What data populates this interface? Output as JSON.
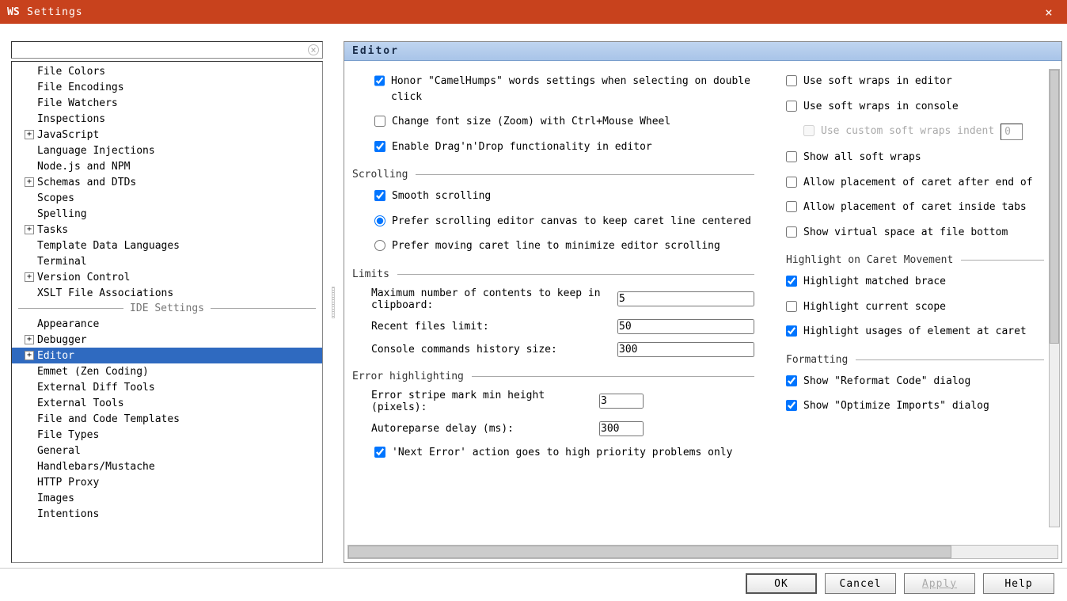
{
  "window": {
    "title": "Settings",
    "logo_letter": "WS"
  },
  "search": {
    "placeholder": ""
  },
  "tree": [
    {
      "label": "File Colors",
      "indent": 1,
      "exp": null
    },
    {
      "label": "File Encodings",
      "indent": 1,
      "exp": null
    },
    {
      "label": "File Watchers",
      "indent": 1,
      "exp": null
    },
    {
      "label": "Inspections",
      "indent": 1,
      "exp": null
    },
    {
      "label": "JavaScript",
      "indent": 1,
      "exp": "+"
    },
    {
      "label": "Language Injections",
      "indent": 1,
      "exp": null
    },
    {
      "label": "Node.js and NPM",
      "indent": 1,
      "exp": null
    },
    {
      "label": "Schemas and DTDs",
      "indent": 1,
      "exp": "+"
    },
    {
      "label": "Scopes",
      "indent": 1,
      "exp": null
    },
    {
      "label": "Spelling",
      "indent": 1,
      "exp": null
    },
    {
      "label": "Tasks",
      "indent": 1,
      "exp": "+"
    },
    {
      "label": "Template Data Languages",
      "indent": 1,
      "exp": null
    },
    {
      "label": "Terminal",
      "indent": 1,
      "exp": null
    },
    {
      "label": "Version Control",
      "indent": 1,
      "exp": "+"
    },
    {
      "label": "XSLT File Associations",
      "indent": 1,
      "exp": null
    },
    {
      "divider": "IDE Settings"
    },
    {
      "label": "Appearance",
      "indent": 1,
      "exp": null
    },
    {
      "label": "Debugger",
      "indent": 1,
      "exp": "+"
    },
    {
      "label": "Editor",
      "indent": 1,
      "exp": "+",
      "selected": true
    },
    {
      "label": "Emmet (Zen Coding)",
      "indent": 1,
      "exp": null
    },
    {
      "label": "External Diff Tools",
      "indent": 1,
      "exp": null
    },
    {
      "label": "External Tools",
      "indent": 1,
      "exp": null
    },
    {
      "label": "File and Code Templates",
      "indent": 1,
      "exp": null
    },
    {
      "label": "File Types",
      "indent": 1,
      "exp": null
    },
    {
      "label": "General",
      "indent": 1,
      "exp": null
    },
    {
      "label": "Handlebars/Mustache",
      "indent": 1,
      "exp": null
    },
    {
      "label": "HTTP Proxy",
      "indent": 1,
      "exp": null
    },
    {
      "label": "Images",
      "indent": 1,
      "exp": null
    },
    {
      "label": "Intentions",
      "indent": 1,
      "exp": null
    }
  ],
  "page_title": "Editor",
  "mouse": {
    "camelhumps": {
      "label": "Honor \"CamelHumps\" words settings when selecting on double click",
      "checked": true
    },
    "zoom_font": {
      "label": "Change font size (Zoom) with Ctrl+Mouse Wheel",
      "checked": false
    },
    "dnd": {
      "label": "Enable Drag'n'Drop functionality in editor",
      "checked": true
    }
  },
  "scrolling": {
    "title": "Scrolling",
    "smooth": {
      "label": "Smooth scrolling",
      "checked": true
    },
    "prefer_canvas": {
      "label": "Prefer scrolling editor canvas to keep caret line centered"
    },
    "prefer_move": {
      "label": "Prefer moving caret line to minimize editor scrolling"
    },
    "selected": "canvas"
  },
  "limits": {
    "title": "Limits",
    "clipboard": {
      "label": "Maximum number of contents to keep in clipboard:",
      "value": "5"
    },
    "recent": {
      "label": "Recent files limit:",
      "value": "50"
    },
    "console": {
      "label": "Console commands history size:",
      "value": "300"
    }
  },
  "error": {
    "title": "Error highlighting",
    "stripe": {
      "label": "Error stripe mark min height (pixels):",
      "value": "3"
    },
    "delay": {
      "label": "Autoreparse delay (ms):",
      "value": "300"
    },
    "next_error": {
      "label": "'Next Error' action goes to high priority problems only",
      "checked": true
    }
  },
  "softwraps": {
    "editor": {
      "label": "Use soft wraps in editor",
      "checked": false
    },
    "console": {
      "label": "Use soft wraps in console",
      "checked": false
    },
    "custom_indent": {
      "label": "Use custom soft wraps indent",
      "checked": false,
      "value": "0"
    },
    "show_all": {
      "label": "Show all soft wraps",
      "checked": false
    },
    "caret_end": {
      "label": "Allow placement of caret after end of",
      "checked": false
    },
    "caret_tabs": {
      "label": "Allow placement of caret inside tabs",
      "checked": false
    },
    "virtual_space": {
      "label": "Show virtual space at file bottom",
      "checked": false
    }
  },
  "highlight": {
    "title": "Highlight on Caret Movement",
    "brace": {
      "label": "Highlight matched brace",
      "checked": true
    },
    "scope": {
      "label": "Highlight current scope",
      "checked": false
    },
    "usages": {
      "label": "Highlight usages of element at caret",
      "checked": true
    }
  },
  "formatting": {
    "title": "Formatting",
    "reformat": {
      "label": "Show \"Reformat Code\" dialog",
      "checked": true
    },
    "optimize": {
      "label": "Show \"Optimize Imports\" dialog",
      "checked": true
    }
  },
  "buttons": {
    "ok": "OK",
    "cancel": "Cancel",
    "apply": "Apply",
    "help": "Help"
  }
}
